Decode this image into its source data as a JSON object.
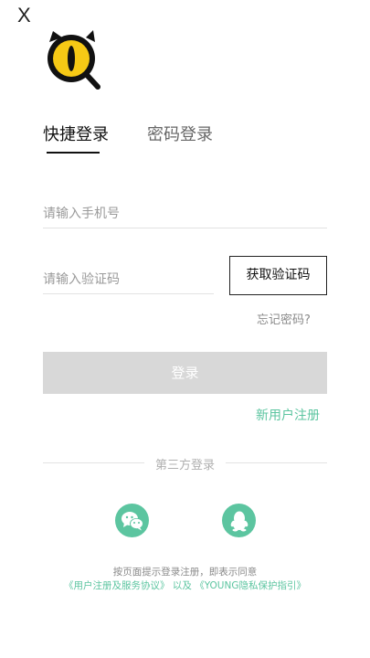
{
  "header": {
    "close_label": "X"
  },
  "tabs": [
    {
      "label": "快捷登录",
      "active": true
    },
    {
      "label": "密码登录",
      "active": false
    }
  ],
  "form": {
    "phone_placeholder": "请输入手机号",
    "code_placeholder": "请输入验证码",
    "get_code_label": "获取验证码",
    "forgot_label": "忘记密码?",
    "login_label": "登录",
    "register_label": "新用户注册"
  },
  "third_party": {
    "label": "第三方登录",
    "providers": [
      "wechat",
      "qq"
    ]
  },
  "agreement": {
    "line1": "按页面提示登录注册，即表示同意",
    "terms_link": "《用户注册及服务协议》",
    "conjunction": "以及",
    "privacy_link": "《YOUNG隐私保护指引》"
  },
  "colors": {
    "accent": "#5cc5a0",
    "logo_yellow": "#f6c915",
    "button_disabled": "#d8d8d8"
  },
  "icons": {
    "logo": "cat-eye-magnifier-logo",
    "close": "close-icon",
    "wechat": "wechat-icon",
    "qq": "qq-penguin-icon"
  }
}
